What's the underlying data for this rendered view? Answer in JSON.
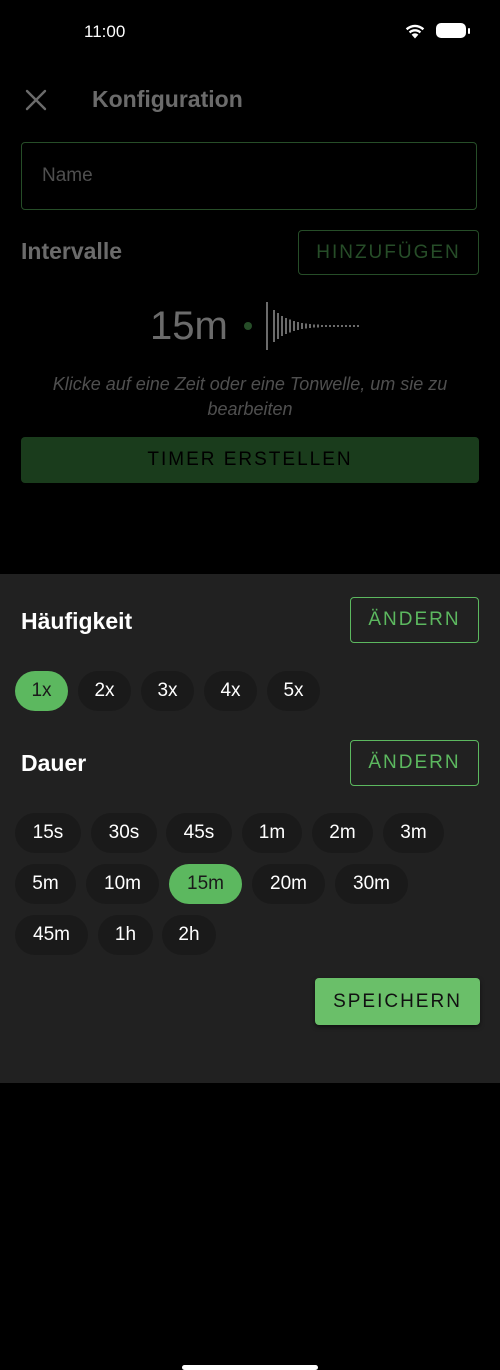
{
  "status_bar": {
    "time": "11:00"
  },
  "header": {
    "title": "Konfiguration"
  },
  "name_field": {
    "placeholder": "Name",
    "value": ""
  },
  "intervals": {
    "label": "Intervalle",
    "add_label": "HINZUFÜGEN",
    "interval_time": "15m",
    "hint": "Klicke auf eine Zeit oder eine Tonwelle, um sie zu bearbeiten",
    "create_label": "TIMER ERSTELLEN"
  },
  "sheet": {
    "frequency": {
      "label": "Häufigkeit",
      "change_label": "ÄNDERN",
      "options": [
        "1x",
        "2x",
        "3x",
        "4x",
        "5x"
      ],
      "selected": "1x"
    },
    "duration": {
      "label": "Dauer",
      "change_label": "ÄNDERN",
      "options": [
        "15s",
        "30s",
        "45s",
        "1m",
        "2m",
        "3m",
        "5m",
        "10m",
        "15m",
        "20m",
        "30m",
        "45m",
        "1h",
        "2h"
      ],
      "selected": "15m"
    },
    "save_label": "SPEICHERN"
  },
  "colors": {
    "accent": "#5cb85f",
    "sheet_bg": "#212121",
    "chip_bg": "#1a1a1a"
  }
}
